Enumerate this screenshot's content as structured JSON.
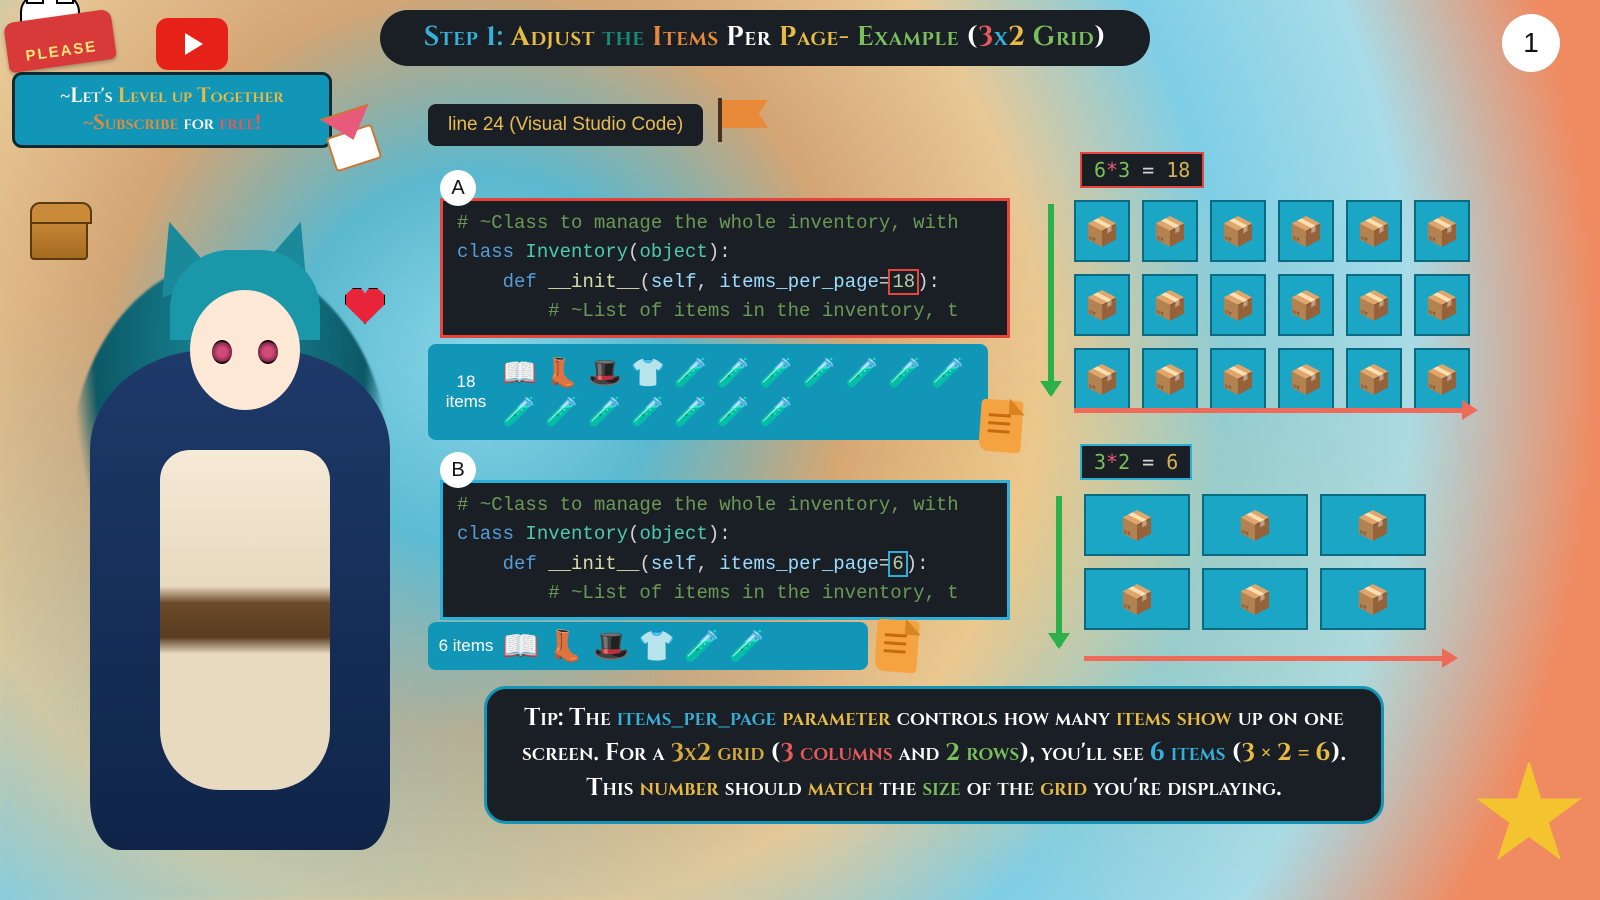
{
  "page_number": "1",
  "title": {
    "segments": [
      {
        "t": "Step 1:",
        "c": "c-blue"
      },
      {
        "t": " Adjust",
        "c": "c-yel"
      },
      {
        "t": " the",
        "c": "c-tealtxt"
      },
      {
        "t": " Items",
        "c": "c-ora"
      },
      {
        "t": " Per",
        "c": "c-wht"
      },
      {
        "t": " Page-",
        "c": "c-yel"
      },
      {
        "t": " Example",
        "c": "c-grn"
      },
      {
        "t": " (",
        "c": "c-wht"
      },
      {
        "t": "3",
        "c": "c-red"
      },
      {
        "t": "x",
        "c": "c-blue"
      },
      {
        "t": "2 ",
        "c": "c-yel"
      },
      {
        "t": "Grid",
        "c": "c-grn"
      },
      {
        "t": ")",
        "c": "c-wht"
      }
    ]
  },
  "please_label": "PLEASE",
  "subscribe": {
    "line1": [
      {
        "t": "~Let's ",
        "c": "c-wht"
      },
      {
        "t": "Level up Together",
        "c": "c-yel"
      }
    ],
    "line2": [
      {
        "t": "~Subscribe",
        "c": "c-ora"
      },
      {
        "t": " for ",
        "c": "c-wht"
      },
      {
        "t": "free!",
        "c": "c-red"
      }
    ]
  },
  "line_pill": "line 24 (Visual Studio Code)",
  "letter_a": "A",
  "letter_b": "B",
  "code_a": {
    "comment1": "# ~Class to manage the whole inventory, with",
    "kw_class": "class",
    "cls_name": "Inventory",
    "obj": "object",
    "kw_def": "def",
    "fn": "__init__",
    "self": "self",
    "param": "items_per_page",
    "value": "18",
    "comment2": "# ~List of items in the inventory, t"
  },
  "code_b": {
    "comment1": "# ~Class to manage the whole inventory, with",
    "kw_class": "class",
    "cls_name": "Inventory",
    "obj": "object",
    "kw_def": "def",
    "fn": "__init__",
    "self": "self",
    "param": "items_per_page",
    "value": "6",
    "comment2": "# ~List of items in the inventory, t"
  },
  "strip_a_label": "18 items",
  "strip_a_icons": [
    "📖",
    "👢",
    "🎩",
    "👕",
    "🧪",
    "🧪",
    "🧪",
    "🧪",
    "🧪",
    "🧪",
    "🧪",
    "🧪",
    "🧪",
    "🧪",
    "🧪",
    "🧪",
    "🧪",
    "🧪"
  ],
  "strip_b_label": "6 items",
  "strip_b_icons": [
    "📖",
    "👢",
    "🎩",
    "👕",
    "🧪",
    "🧪"
  ],
  "grid_a": {
    "lhs_a": "6",
    "star": "*",
    "lhs_b": "3",
    "eq": " = ",
    "rhs": "18",
    "cols": 6,
    "rows": 3
  },
  "grid_b": {
    "lhs_a": "3",
    "star": "*",
    "lhs_b": "2",
    "eq": " = ",
    "rhs": "6",
    "cols": 3,
    "rows": 2
  },
  "tip": [
    {
      "t": "Tip: The ",
      "c": "c-wht"
    },
    {
      "t": "items_per_page",
      "c": "c-blue"
    },
    {
      "t": " parameter",
      "c": "c-yel"
    },
    {
      "t": " controls how many ",
      "c": "c-wht"
    },
    {
      "t": "items show",
      "c": "c-yel"
    },
    {
      "t": " up on one screen. For a ",
      "c": "c-wht"
    },
    {
      "t": "3x2 grid",
      "c": "c-gold"
    },
    {
      "t": " (",
      "c": "c-wht"
    },
    {
      "t": "3 columns",
      "c": "c-red"
    },
    {
      "t": " and ",
      "c": "c-wht"
    },
    {
      "t": "2 rows",
      "c": "c-grn"
    },
    {
      "t": "), you'll see ",
      "c": "c-wht"
    },
    {
      "t": "6 items",
      "c": "c-blue"
    },
    {
      "t": " (",
      "c": "c-wht"
    },
    {
      "t": "3 × 2 = 6",
      "c": "c-yel"
    },
    {
      "t": "). This ",
      "c": "c-wht"
    },
    {
      "t": "number",
      "c": "c-yel"
    },
    {
      "t": " should ",
      "c": "c-wht"
    },
    {
      "t": "match",
      "c": "c-yel"
    },
    {
      "t": " the ",
      "c": "c-wht"
    },
    {
      "t": "size",
      "c": "c-grn"
    },
    {
      "t": " of the ",
      "c": "c-wht"
    },
    {
      "t": "grid",
      "c": "c-yel"
    },
    {
      "t": " you're displaying.",
      "c": "c-wht"
    }
  ]
}
